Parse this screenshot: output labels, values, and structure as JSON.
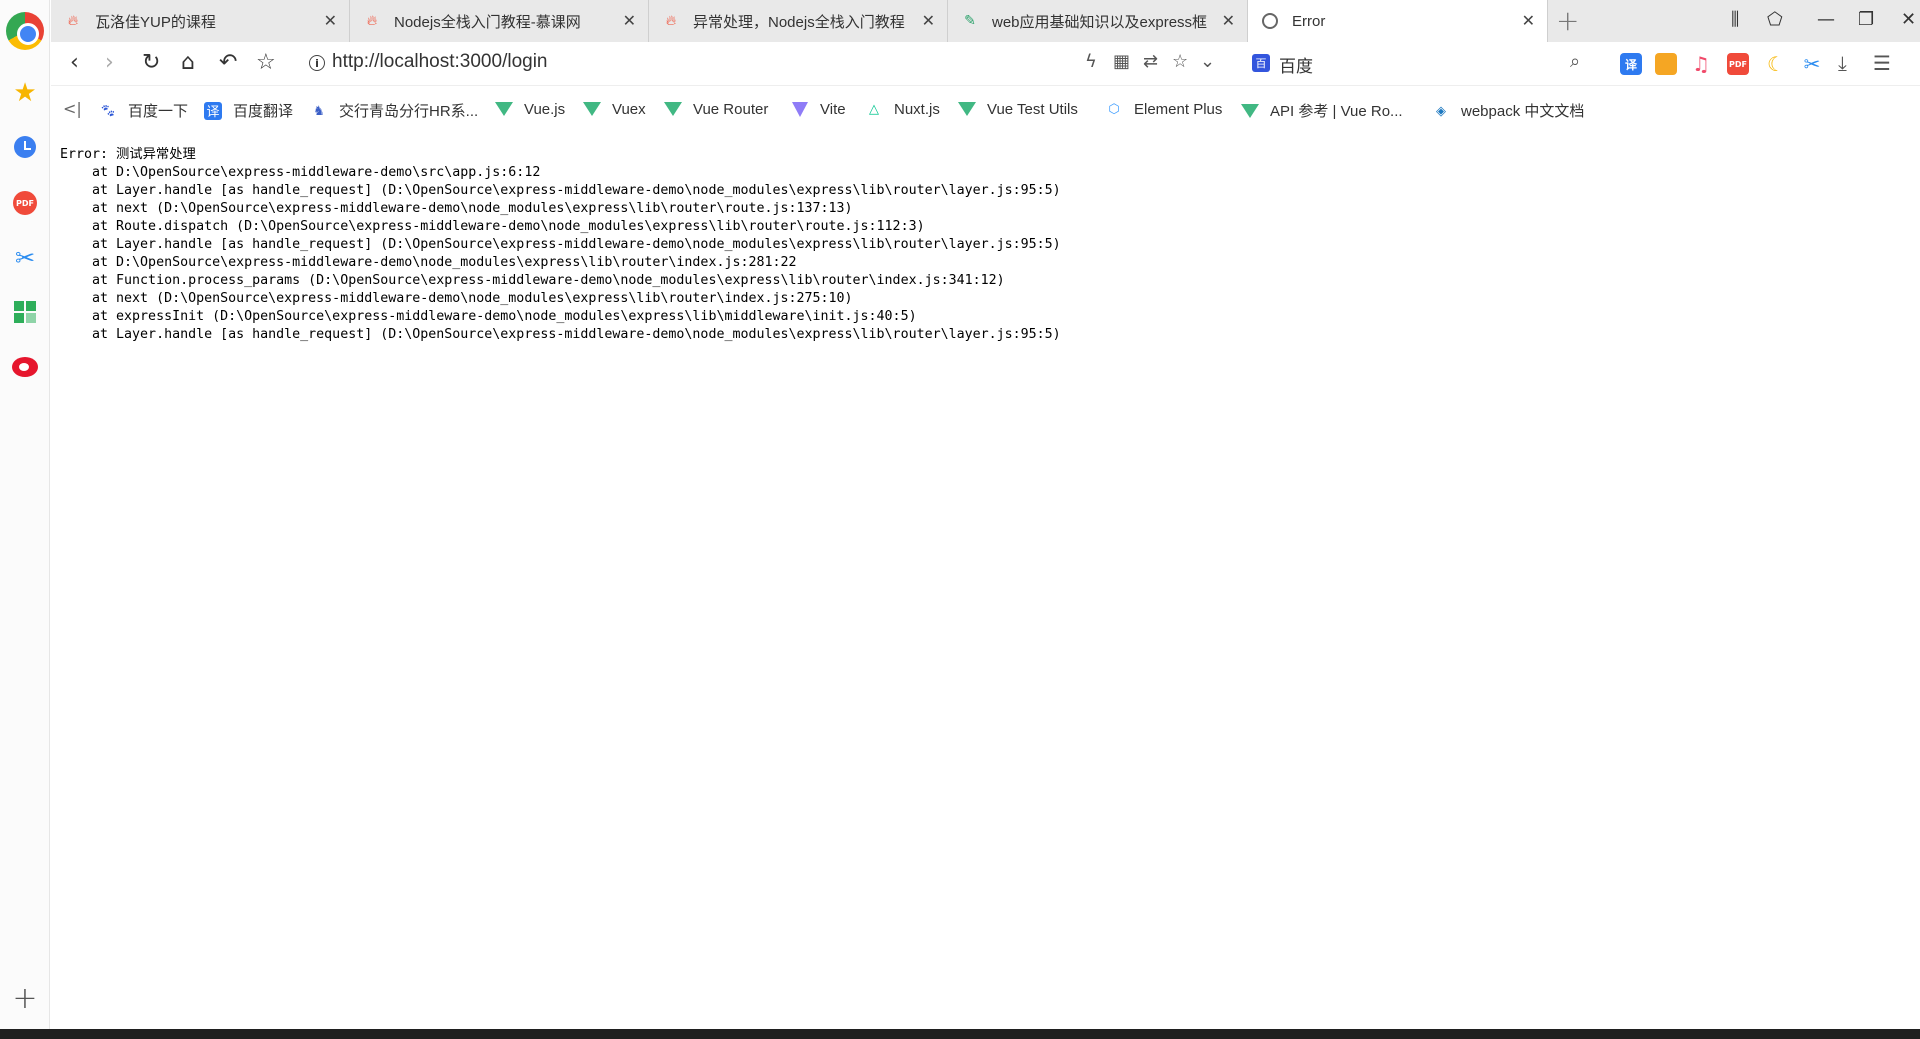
{
  "tabs": [
    {
      "title": "瓦洛佳YUP的课程",
      "icon": "fire-icon",
      "active": false
    },
    {
      "title": "Nodejs全栈入门教程-慕课网",
      "icon": "fire-icon",
      "active": false
    },
    {
      "title": "异常处理，Nodejs全栈入门教程",
      "icon": "fire-icon",
      "active": false
    },
    {
      "title": "web应用基础知识以及express框",
      "icon": "feather-icon",
      "active": false
    },
    {
      "title": "Error",
      "icon": "globe-icon",
      "active": true
    }
  ],
  "addressbar": {
    "url": "http://localhost:3000/login",
    "search_engine": "百度"
  },
  "bookmarks": [
    {
      "label": "百度一下",
      "icon": "baidu-paw-icon"
    },
    {
      "label": "百度翻译",
      "icon": "fanyi-icon"
    },
    {
      "label": "交行青岛分行HR系...",
      "icon": "bank-icon"
    },
    {
      "label": "Vue.js",
      "icon": "vue-icon"
    },
    {
      "label": "Vuex",
      "icon": "vue-icon"
    },
    {
      "label": "Vue Router",
      "icon": "vue-icon"
    },
    {
      "label": "Vite",
      "icon": "vite-icon"
    },
    {
      "label": "Nuxt.js",
      "icon": "nuxt-icon"
    },
    {
      "label": "Vue Test Utils",
      "icon": "vue-icon"
    },
    {
      "label": "Element Plus",
      "icon": "element-icon"
    },
    {
      "label": "API 参考 | Vue Ro...",
      "icon": "vue-icon"
    },
    {
      "label": "webpack 中文文档",
      "icon": "webpack-icon"
    }
  ],
  "page": {
    "error_text": "Error: 测试异常处理\n    at D:\\OpenSource\\express-middleware-demo\\src\\app.js:6:12\n    at Layer.handle [as handle_request] (D:\\OpenSource\\express-middleware-demo\\node_modules\\express\\lib\\router\\layer.js:95:5)\n    at next (D:\\OpenSource\\express-middleware-demo\\node_modules\\express\\lib\\router\\route.js:137:13)\n    at Route.dispatch (D:\\OpenSource\\express-middleware-demo\\node_modules\\express\\lib\\router\\route.js:112:3)\n    at Layer.handle [as handle_request] (D:\\OpenSource\\express-middleware-demo\\node_modules\\express\\lib\\router\\layer.js:95:5)\n    at D:\\OpenSource\\express-middleware-demo\\node_modules\\express\\lib\\router\\index.js:281:22\n    at Function.process_params (D:\\OpenSource\\express-middleware-demo\\node_modules\\express\\lib\\router\\index.js:341:12)\n    at next (D:\\OpenSource\\express-middleware-demo\\node_modules\\express\\lib\\router\\index.js:275:10)\n    at expressInit (D:\\OpenSource\\express-middleware-demo\\node_modules\\express\\lib\\middleware\\init.js:40:5)\n    at Layer.handle [as handle_request] (D:\\OpenSource\\express-middleware-demo\\node_modules\\express\\lib\\router\\layer.js:95:5)"
  },
  "extensions": [
    {
      "name": "translate-ext-icon",
      "text": "译",
      "color": "#2e7af0"
    },
    {
      "name": "apps-ext-icon",
      "text": "",
      "color": "#f5a623"
    },
    {
      "name": "music-ext-icon",
      "text": "♫",
      "color": "#f04a6a"
    },
    {
      "name": "pdf-ext-icon",
      "text": "PDF",
      "color": "#f04a3a"
    },
    {
      "name": "moon-ext-icon",
      "text": "☾",
      "color": "#f7b500"
    },
    {
      "name": "scissors-ext-icon",
      "text": "✂",
      "color": "#2b8cf0"
    }
  ]
}
